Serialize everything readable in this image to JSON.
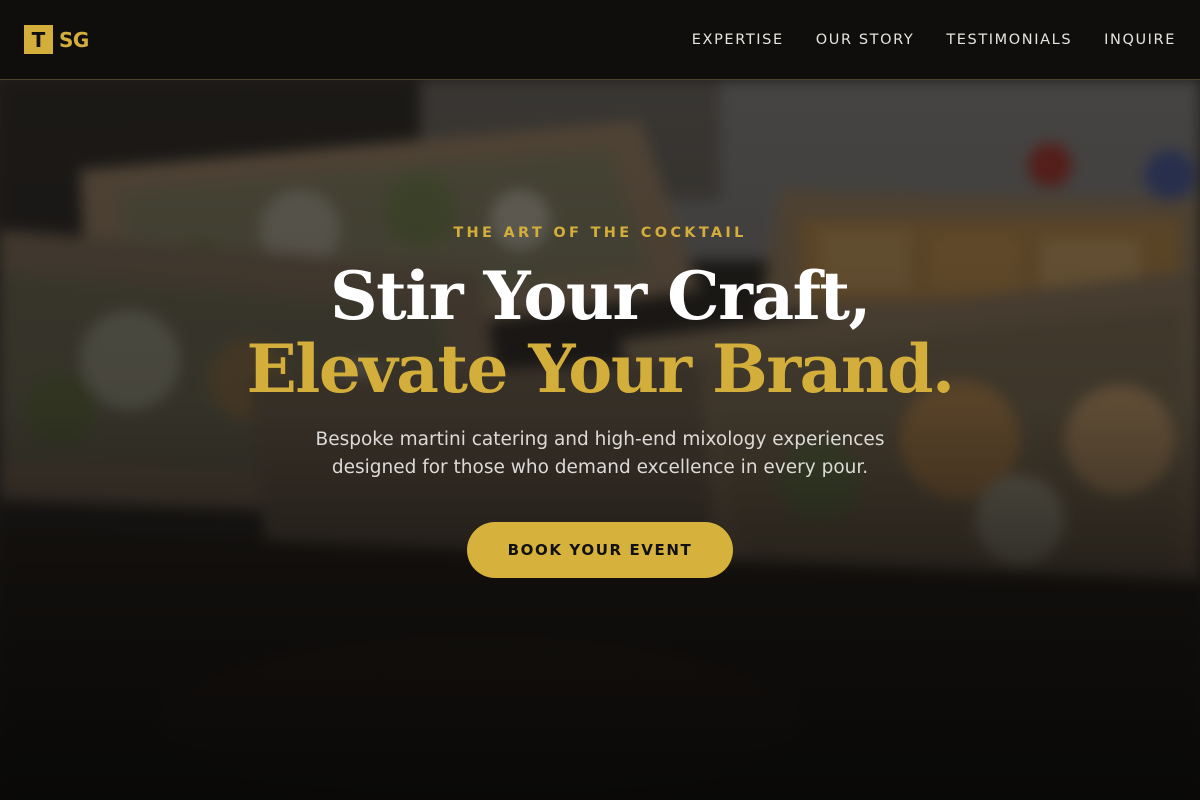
{
  "header": {
    "logo": {
      "box_letter": "T",
      "rest": "SG"
    },
    "nav": [
      {
        "label": "EXPERTISE"
      },
      {
        "label": "OUR STORY"
      },
      {
        "label": "TESTIMONIALS"
      },
      {
        "label": "INQUIRE"
      }
    ]
  },
  "hero": {
    "eyebrow": "THE ART OF THE COCKTAIL",
    "headline_line1": "Stir Your Craft,",
    "headline_line2": "Elevate Your Brand.",
    "subtext": "Bespoke martini catering and high-end mixology experiences designed for those who demand excellence in every pour.",
    "cta_label": "BOOK YOUR EVENT"
  },
  "colors": {
    "accent_gold": "#d4ae3a",
    "header_bg": "#0f0e0d",
    "headline_white": "#ffffff",
    "body_text": "#dcdad6"
  }
}
